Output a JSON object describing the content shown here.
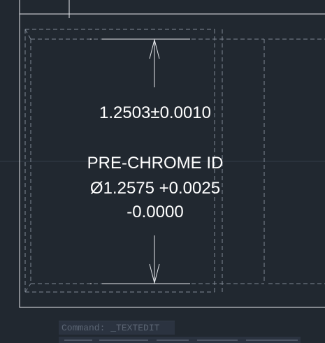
{
  "app": {
    "name": "CAD drawing editor",
    "background_color": "#212830",
    "geometry_color": "#e8ecf0",
    "hidden_line_color": "#7f8894",
    "centerline_color": "#3b4450"
  },
  "annotations": {
    "length_dimension": "1.2503±0.0010",
    "bore_label": "PRE-CHROME ID",
    "bore_diameter": "Ø1.2575 +0.0025",
    "bore_lower_tolerance": "-0.0000"
  },
  "command_line": {
    "prompt_text": "Command: _TEXTEDIT"
  }
}
